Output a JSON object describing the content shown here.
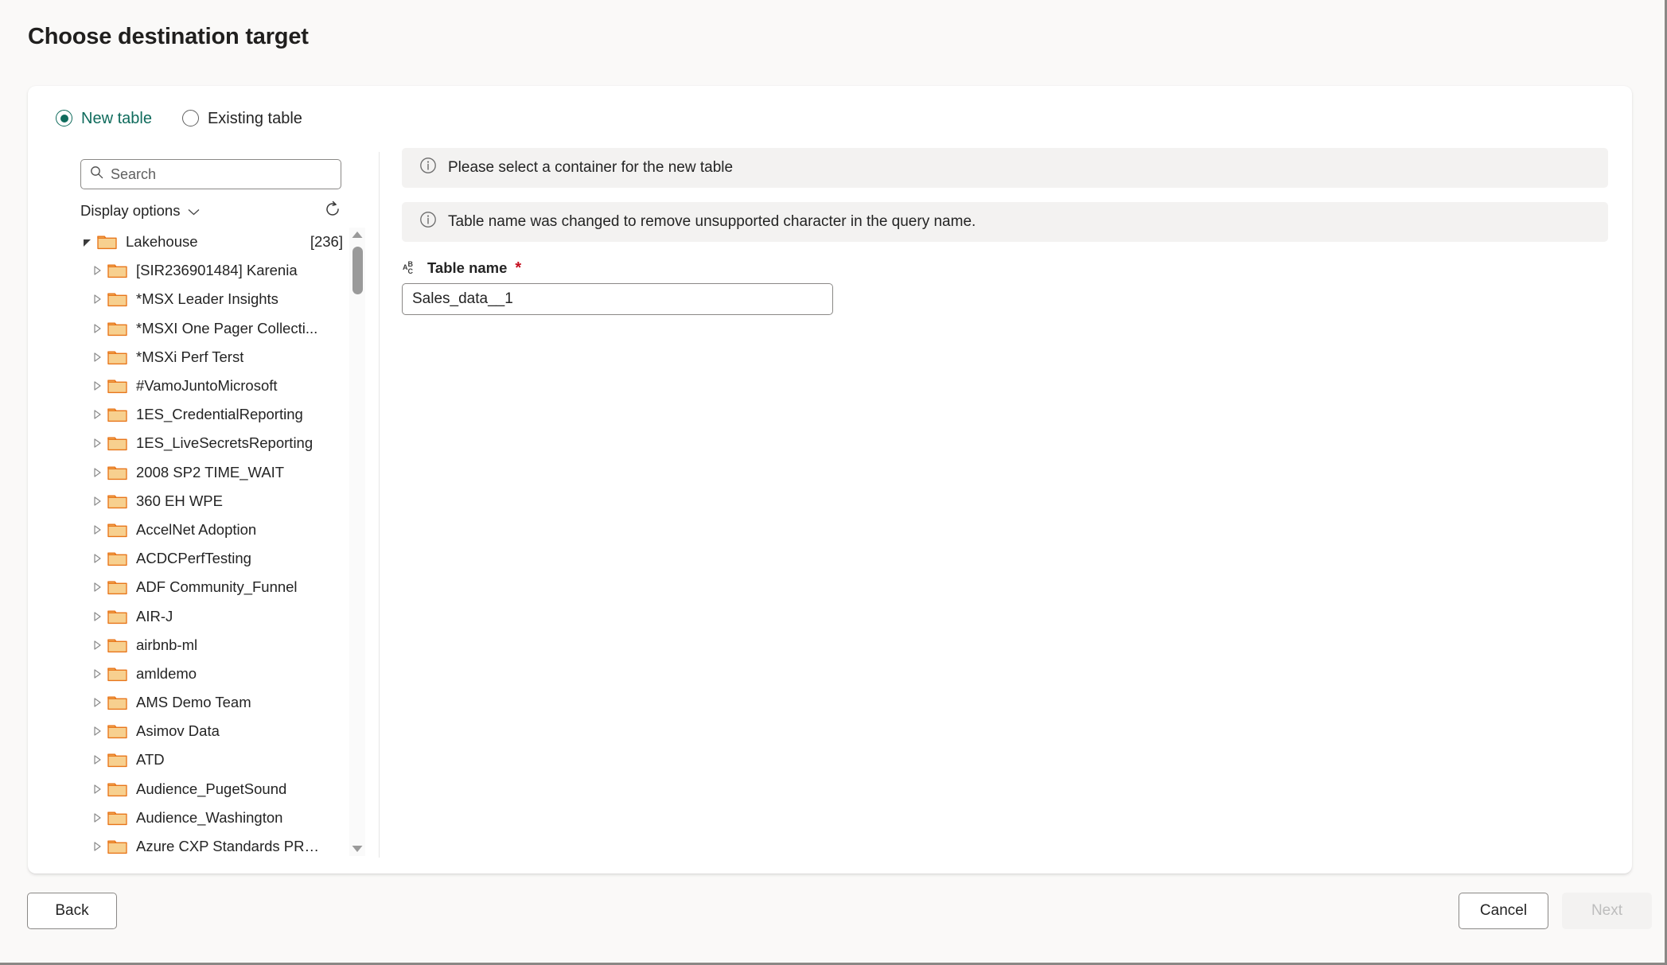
{
  "page": {
    "title": "Choose destination target"
  },
  "destination_mode": {
    "options": [
      {
        "label": "New table",
        "selected": true
      },
      {
        "label": "Existing table",
        "selected": false
      }
    ]
  },
  "navigator": {
    "search": {
      "placeholder": "Search",
      "value": "",
      "icon": "search-icon"
    },
    "display_options": {
      "label": "Display options",
      "chevron_icon": "chevron-down-icon"
    },
    "refresh": {
      "icon": "refresh-icon",
      "tooltip": "Refresh"
    },
    "tree": {
      "root": {
        "label": "Lakehouse",
        "count": "[236]",
        "expanded": true,
        "icon": "folder-icon"
      },
      "items": [
        {
          "label": "[SIR236901484] Karenia"
        },
        {
          "label": "*MSX Leader Insights"
        },
        {
          "label": "*MSXI One Pager Collecti..."
        },
        {
          "label": "*MSXi Perf Terst"
        },
        {
          "label": "#VamoJuntoMicrosoft"
        },
        {
          "label": "1ES_CredentialReporting"
        },
        {
          "label": "1ES_LiveSecretsReporting"
        },
        {
          "label": "2008 SP2 TIME_WAIT"
        },
        {
          "label": "360 EH WPE"
        },
        {
          "label": "AccelNet Adoption"
        },
        {
          "label": "ACDCPerfTesting"
        },
        {
          "label": "ADF Community_Funnel"
        },
        {
          "label": "AIR-J"
        },
        {
          "label": "airbnb-ml"
        },
        {
          "label": "amldemo"
        },
        {
          "label": "AMS Demo Team"
        },
        {
          "label": "Asimov Data"
        },
        {
          "label": "ATD"
        },
        {
          "label": "Audience_PugetSound"
        },
        {
          "label": "Audience_Washington"
        },
        {
          "label": "Azure CXP Standards PROD"
        }
      ]
    }
  },
  "detail": {
    "messages": [
      {
        "icon": "info-icon",
        "text": "Please select a container for the new table"
      },
      {
        "icon": "info-icon",
        "text": "Table name was changed to remove unsupported character in the query name."
      }
    ],
    "table_name_field": {
      "type_icon": "abc-text-icon",
      "label": "Table name",
      "required_marker": "*",
      "value": "Sales_data__1",
      "placeholder": ""
    }
  },
  "footer": {
    "back_label": "Back",
    "cancel_label": "Cancel",
    "next_label": "Next"
  },
  "colors": {
    "accent": "#0f6b5c",
    "folder": "#f5c26b",
    "folder_outline": "#e8751a",
    "required": "#c50f1f",
    "page_bg": "#faf9f8",
    "card_bg": "#ffffff",
    "message_bg": "#f3f2f1"
  }
}
